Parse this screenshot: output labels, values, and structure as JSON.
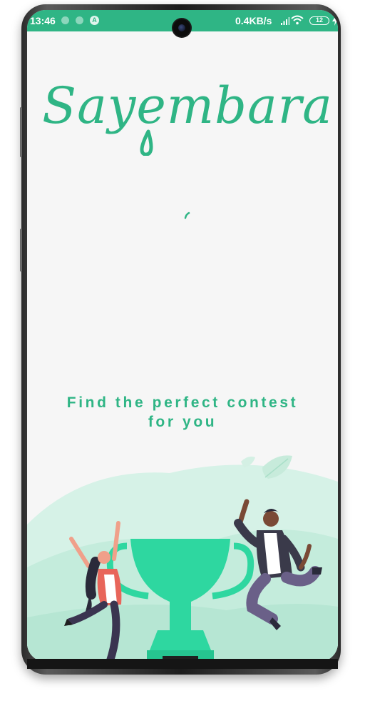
{
  "status_bar": {
    "time": "13:46",
    "network_speed": "0.4KB/s",
    "battery_level": "12",
    "notification_icon_label": "A",
    "icons": [
      "notification-dot-icon",
      "notification-dot-icon",
      "app-a-icon",
      "signal-icon",
      "wifi-icon",
      "battery-icon",
      "charging-icon"
    ],
    "color": "#2fb585"
  },
  "app": {
    "logo_text": "Sayembara",
    "brand_color": "#2fb585"
  },
  "main": {
    "tagline_line1": "Find the perfect contest",
    "tagline_line2": "for you",
    "loading_indicator": "spinner-icon"
  },
  "illustration": {
    "subject": "trophy-celebration-illustration",
    "icons": [
      "trophy-icon",
      "leaf-icon",
      "person-jumping-icon"
    ]
  }
}
